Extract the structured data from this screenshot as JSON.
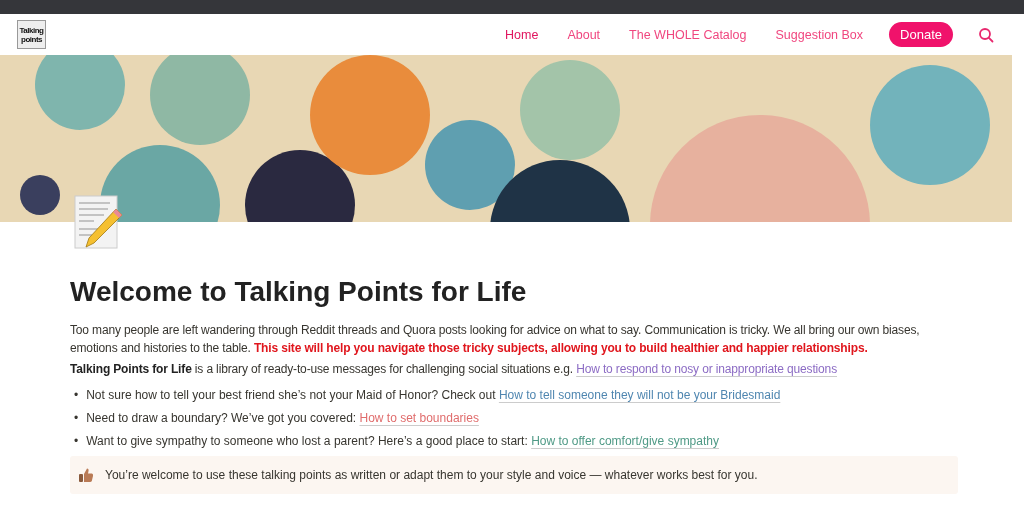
{
  "logo": {
    "line_1": "Talking",
    "line_2": "points"
  },
  "nav": [
    {
      "label": "Home",
      "selected": true
    },
    {
      "label": "About",
      "selected": false
    },
    {
      "label": "The WHOLE Catalog",
      "selected": false
    },
    {
      "label": "Suggestion Box",
      "selected": false
    }
  ],
  "donate_button": "Donate",
  "title": "Welcome to Talking Points for Life",
  "intro": {
    "text": "Too many people are left wandering through Reddit threads and Quora posts looking for advice on what to say. Communication is tricky. We all bring our own biases, emotions and histories to the table. ",
    "highlight": "This site will help you navigate those tricky subjects, allowing you to build healthier and happier relationships."
  },
  "summary": {
    "lead": "Talking Points for Life",
    "text": " is a library of ready-to-use messages for challenging social situations e.g. ",
    "link": {
      "label": "How to respond to nosy or inappropriate questions",
      "color": "#8c6cc4"
    }
  },
  "bullets": [
    {
      "marker": "•",
      "text": "Not sure how to tell your best friend she’s not your Maid of Honor? Check out ",
      "link": {
        "label": "How to tell someone they will not be your Bridesmaid",
        "color": "#4f86b0"
      }
    },
    {
      "marker": "•",
      "text": "Need to draw a boundary? We’ve got you covered: ",
      "link": {
        "label": "How to set boundaries",
        "color": "#e06c6c"
      }
    },
    {
      "marker": "•",
      "text": "Want to give sympathy to someone who lost a parent? Here’s a good place to start: ",
      "link": {
        "label": "How to offer comfort/give sympathy",
        "color": "#4f9a86"
      }
    }
  ],
  "callout": {
    "text": "You’re welcome to use these talking points as written or adapt them to your style and voice — whatever works best for you."
  }
}
